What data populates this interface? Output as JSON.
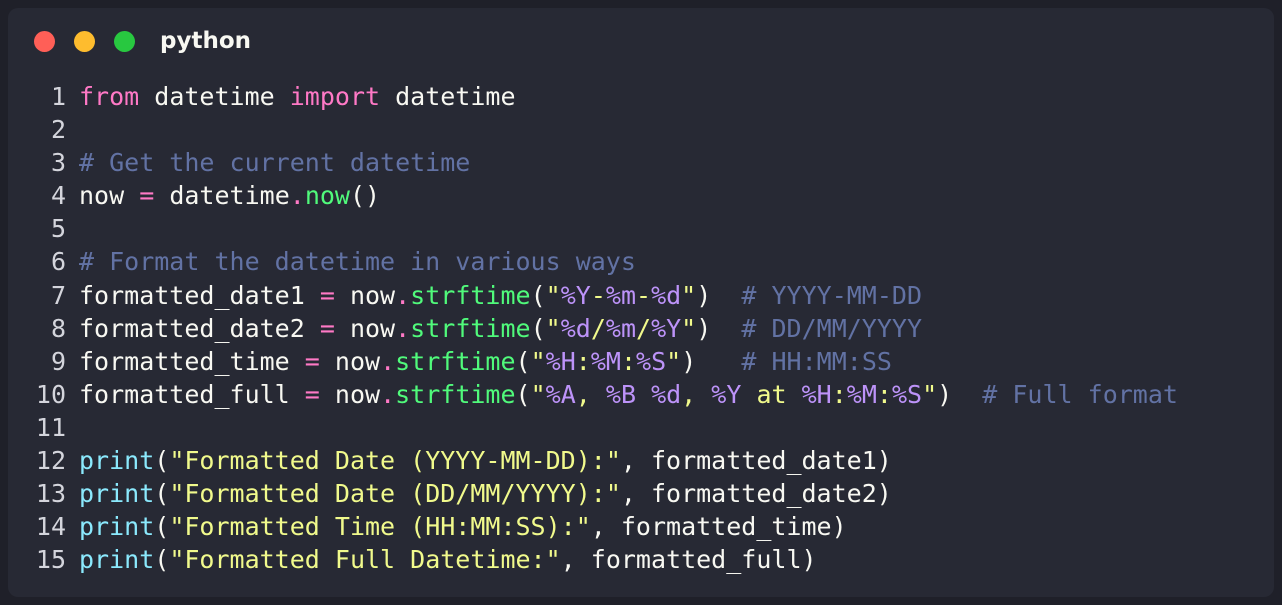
{
  "window": {
    "title": "python",
    "controls": {
      "close_color": "#ff5f57",
      "minimize_color": "#febc2e",
      "maximize_color": "#28c840"
    }
  },
  "editor": {
    "colors": {
      "plain": "#f8f8f2",
      "keyword": "#ff79c6",
      "comment": "#6272a4",
      "function": "#50fa7b",
      "builtin": "#8be9fd",
      "string": "#f1fa8c",
      "format": "#bd93f9",
      "operator": "#ff79c6"
    },
    "lines": [
      {
        "number": "1",
        "tokens": [
          {
            "t": "from",
            "k": "keyword"
          },
          {
            "t": " datetime ",
            "k": "plain"
          },
          {
            "t": "import",
            "k": "keyword"
          },
          {
            "t": " datetime",
            "k": "plain"
          }
        ]
      },
      {
        "number": "2",
        "tokens": []
      },
      {
        "number": "3",
        "tokens": [
          {
            "t": "# Get the current datetime",
            "k": "comment"
          }
        ]
      },
      {
        "number": "4",
        "tokens": [
          {
            "t": "now ",
            "k": "plain"
          },
          {
            "t": "=",
            "k": "operator"
          },
          {
            "t": " datetime",
            "k": "plain"
          },
          {
            "t": ".",
            "k": "operator"
          },
          {
            "t": "now",
            "k": "function"
          },
          {
            "t": "()",
            "k": "plain"
          }
        ]
      },
      {
        "number": "5",
        "tokens": []
      },
      {
        "number": "6",
        "tokens": [
          {
            "t": "# Format the datetime in various ways",
            "k": "comment"
          }
        ]
      },
      {
        "number": "7",
        "tokens": [
          {
            "t": "formatted_date1 ",
            "k": "plain"
          },
          {
            "t": "=",
            "k": "operator"
          },
          {
            "t": " now",
            "k": "plain"
          },
          {
            "t": ".",
            "k": "operator"
          },
          {
            "t": "strftime",
            "k": "function"
          },
          {
            "t": "(",
            "k": "plain"
          },
          {
            "t": "\"",
            "k": "string"
          },
          {
            "t": "%Y",
            "k": "format"
          },
          {
            "t": "-",
            "k": "string"
          },
          {
            "t": "%m",
            "k": "format"
          },
          {
            "t": "-",
            "k": "string"
          },
          {
            "t": "%d",
            "k": "format"
          },
          {
            "t": "\"",
            "k": "string"
          },
          {
            "t": ")  ",
            "k": "plain"
          },
          {
            "t": "# YYYY-MM-DD",
            "k": "comment"
          }
        ]
      },
      {
        "number": "8",
        "tokens": [
          {
            "t": "formatted_date2 ",
            "k": "plain"
          },
          {
            "t": "=",
            "k": "operator"
          },
          {
            "t": " now",
            "k": "plain"
          },
          {
            "t": ".",
            "k": "operator"
          },
          {
            "t": "strftime",
            "k": "function"
          },
          {
            "t": "(",
            "k": "plain"
          },
          {
            "t": "\"",
            "k": "string"
          },
          {
            "t": "%d",
            "k": "format"
          },
          {
            "t": "/",
            "k": "string"
          },
          {
            "t": "%m",
            "k": "format"
          },
          {
            "t": "/",
            "k": "string"
          },
          {
            "t": "%Y",
            "k": "format"
          },
          {
            "t": "\"",
            "k": "string"
          },
          {
            "t": ")  ",
            "k": "plain"
          },
          {
            "t": "# DD/MM/YYYY",
            "k": "comment"
          }
        ]
      },
      {
        "number": "9",
        "tokens": [
          {
            "t": "formatted_time ",
            "k": "plain"
          },
          {
            "t": "=",
            "k": "operator"
          },
          {
            "t": " now",
            "k": "plain"
          },
          {
            "t": ".",
            "k": "operator"
          },
          {
            "t": "strftime",
            "k": "function"
          },
          {
            "t": "(",
            "k": "plain"
          },
          {
            "t": "\"",
            "k": "string"
          },
          {
            "t": "%H",
            "k": "format"
          },
          {
            "t": ":",
            "k": "string"
          },
          {
            "t": "%M",
            "k": "format"
          },
          {
            "t": ":",
            "k": "string"
          },
          {
            "t": "%S",
            "k": "format"
          },
          {
            "t": "\"",
            "k": "string"
          },
          {
            "t": ")   ",
            "k": "plain"
          },
          {
            "t": "# HH:MM:SS",
            "k": "comment"
          }
        ]
      },
      {
        "number": "10",
        "tokens": [
          {
            "t": "formatted_full ",
            "k": "plain"
          },
          {
            "t": "=",
            "k": "operator"
          },
          {
            "t": " now",
            "k": "plain"
          },
          {
            "t": ".",
            "k": "operator"
          },
          {
            "t": "strftime",
            "k": "function"
          },
          {
            "t": "(",
            "k": "plain"
          },
          {
            "t": "\"",
            "k": "string"
          },
          {
            "t": "%A",
            "k": "format"
          },
          {
            "t": ", ",
            "k": "string"
          },
          {
            "t": "%B",
            "k": "format"
          },
          {
            "t": " ",
            "k": "string"
          },
          {
            "t": "%d",
            "k": "format"
          },
          {
            "t": ", ",
            "k": "string"
          },
          {
            "t": "%Y",
            "k": "format"
          },
          {
            "t": " at ",
            "k": "string"
          },
          {
            "t": "%H",
            "k": "format"
          },
          {
            "t": ":",
            "k": "string"
          },
          {
            "t": "%M",
            "k": "format"
          },
          {
            "t": ":",
            "k": "string"
          },
          {
            "t": "%S",
            "k": "format"
          },
          {
            "t": "\"",
            "k": "string"
          },
          {
            "t": ")  ",
            "k": "plain"
          },
          {
            "t": "# Full format",
            "k": "comment"
          }
        ]
      },
      {
        "number": "11",
        "tokens": []
      },
      {
        "number": "12",
        "tokens": [
          {
            "t": "print",
            "k": "builtin"
          },
          {
            "t": "(",
            "k": "plain"
          },
          {
            "t": "\"Formatted Date (YYYY-MM-DD):\"",
            "k": "string"
          },
          {
            "t": ", formatted_date1)",
            "k": "plain"
          }
        ]
      },
      {
        "number": "13",
        "tokens": [
          {
            "t": "print",
            "k": "builtin"
          },
          {
            "t": "(",
            "k": "plain"
          },
          {
            "t": "\"Formatted Date (DD/MM/YYYY):\"",
            "k": "string"
          },
          {
            "t": ", formatted_date2)",
            "k": "plain"
          }
        ]
      },
      {
        "number": "14",
        "tokens": [
          {
            "t": "print",
            "k": "builtin"
          },
          {
            "t": "(",
            "k": "plain"
          },
          {
            "t": "\"Formatted Time (HH:MM:SS):\"",
            "k": "string"
          },
          {
            "t": ", formatted_time)",
            "k": "plain"
          }
        ]
      },
      {
        "number": "15",
        "tokens": [
          {
            "t": "print",
            "k": "builtin"
          },
          {
            "t": "(",
            "k": "plain"
          },
          {
            "t": "\"Formatted Full Datetime:\"",
            "k": "string"
          },
          {
            "t": ", formatted_full)",
            "k": "plain"
          }
        ]
      }
    ]
  }
}
